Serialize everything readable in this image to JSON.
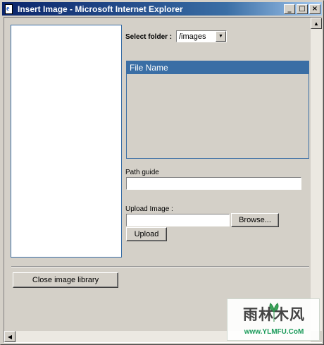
{
  "window": {
    "title": "Insert Image - Microsoft Internet Explorer",
    "minimize_glyph": "_",
    "maximize_glyph": "□",
    "close_glyph": "×"
  },
  "folder": {
    "label": "Select folder :",
    "selected": "/images"
  },
  "file_list": {
    "header": "File Name"
  },
  "path_guide": {
    "label": "Path guide",
    "value": ""
  },
  "upload": {
    "label": "Upload Image :",
    "value": "",
    "browse_label": "Browse...",
    "upload_label": "Upload"
  },
  "close_library_label": "Close image library",
  "watermark": {
    "text": "雨林木风",
    "url": "www.YLMFU.CoM"
  },
  "colors": {
    "title_bar": "#0a246a",
    "accent": "#3a6ea5",
    "face": "#d4d0c8"
  }
}
